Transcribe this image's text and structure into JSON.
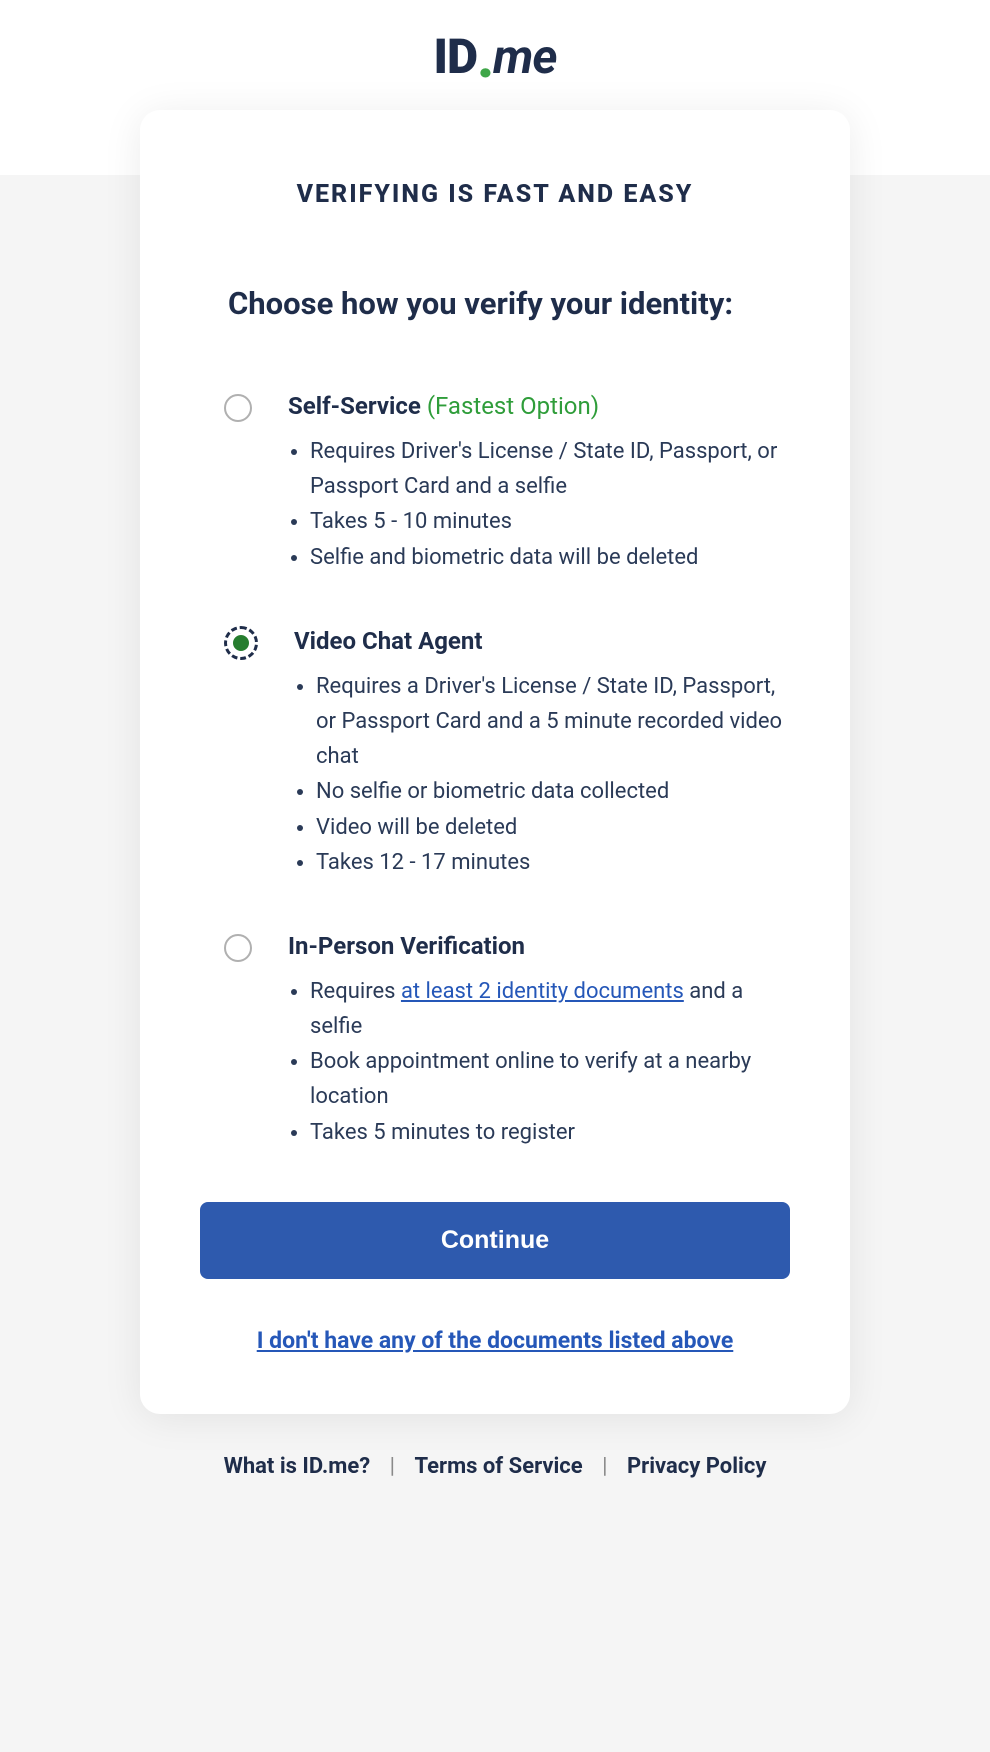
{
  "logo": {
    "id": "ID",
    "dot": ".",
    "me": "me"
  },
  "card": {
    "title": "VERIFYING IS FAST AND EASY",
    "subtitle": "Choose how you verify your identity:"
  },
  "options": [
    {
      "title": "Self-Service",
      "badge": "(Fastest Option)",
      "selected": false,
      "bullets": [
        "Requires Driver's License / State ID, Passport, or Passport Card and a selfie",
        "Takes 5 - 10 minutes",
        "Selfie and biometric data will be deleted"
      ]
    },
    {
      "title": "Video Chat Agent",
      "badge": "",
      "selected": true,
      "bullets": [
        "Requires a Driver's License / State ID, Passport, or Passport Card and a 5 minute recorded video chat",
        "No selfie or biometric data collected",
        "Video will be deleted",
        "Takes 12 - 17 minutes"
      ]
    },
    {
      "title": "In-Person Verification",
      "badge": "",
      "selected": false,
      "bullets_special": {
        "pre": "Requires ",
        "link": "at least 2 identity documents",
        "post": " and a selfie"
      },
      "bullets": [
        "Book appointment online to verify at a nearby location",
        "Takes 5 minutes to register"
      ]
    }
  ],
  "continue_label": "Continue",
  "no_docs_link": "I don't have any of the documents listed above",
  "footer": {
    "what": "What is ID.me?",
    "terms": "Terms of Service",
    "privacy": "Privacy Policy"
  }
}
